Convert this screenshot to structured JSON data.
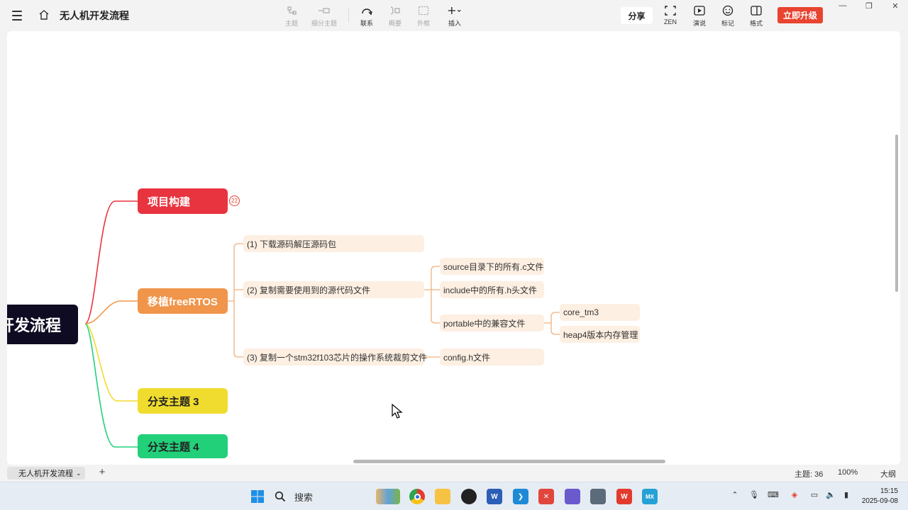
{
  "app": {
    "title": "无人机开发流程"
  },
  "toolbar": {
    "tools": [
      {
        "label": "主题",
        "icon": "topic-icon",
        "enabled": false
      },
      {
        "label": "细分主题",
        "icon": "subtopic-icon",
        "enabled": false
      },
      {
        "label": "联系",
        "icon": "relationship-icon",
        "enabled": true
      },
      {
        "label": "概要",
        "icon": "summary-icon",
        "enabled": false
      },
      {
        "label": "外框",
        "icon": "boundary-icon",
        "enabled": false
      },
      {
        "label": "插入",
        "icon": "insert-plus-icon",
        "enabled": true
      }
    ],
    "share_label": "分享",
    "right_tools": [
      {
        "label": "ZEN",
        "icon": "zen-fullscreen-icon"
      },
      {
        "label": "演说",
        "icon": "pitch-play-icon"
      },
      {
        "label": "标记",
        "icon": "marker-smile-icon"
      },
      {
        "label": "格式",
        "icon": "format-panel-icon"
      }
    ],
    "upgrade_label": "立即升级"
  },
  "mindmap": {
    "root": "开发流程",
    "branches": [
      {
        "label": "项目构建",
        "color": "#e8343f",
        "badge": "22"
      },
      {
        "label": "移植freeRTOS",
        "color": "#f0954a",
        "children": [
          {
            "label": "(1) 下载源码解压源码包"
          },
          {
            "label": "(2) 复制需要使用到的源代码文件",
            "children": [
              {
                "label": "source目录下的所有.c文件"
              },
              {
                "label": "include中的所有.h头文件"
              },
              {
                "label": "portable中的兼容文件",
                "children": [
                  {
                    "label": "core_tm3"
                  },
                  {
                    "label": "heap4版本内存管理"
                  }
                ]
              }
            ]
          },
          {
            "label": "(3) 复制一个stm32f103芯片的操作系统裁剪文件",
            "children": [
              {
                "label": "config.h文件"
              }
            ]
          }
        ]
      },
      {
        "label": "分支主题 3",
        "color": "#f0dc2e"
      },
      {
        "label": "分支主题 4",
        "color": "#22d07a"
      }
    ]
  },
  "sheetbar": {
    "tab_label": "无人机开发流程",
    "topic_count": "主题: 36",
    "zoom": "100%",
    "outline": "大纲"
  },
  "taskbar": {
    "search_placeholder": "搜索",
    "apps": [
      "windows-start-icon",
      "search-icon",
      "widgets-icon",
      "chrome-icon",
      "file-explorer-icon",
      "obs-icon",
      "word-icon",
      "vscode-icon",
      "xmind-icon",
      "books-icon",
      "camera-icon",
      "wps-icon",
      "mx-icon"
    ],
    "time": "15:15",
    "date": "2025-09-08"
  }
}
